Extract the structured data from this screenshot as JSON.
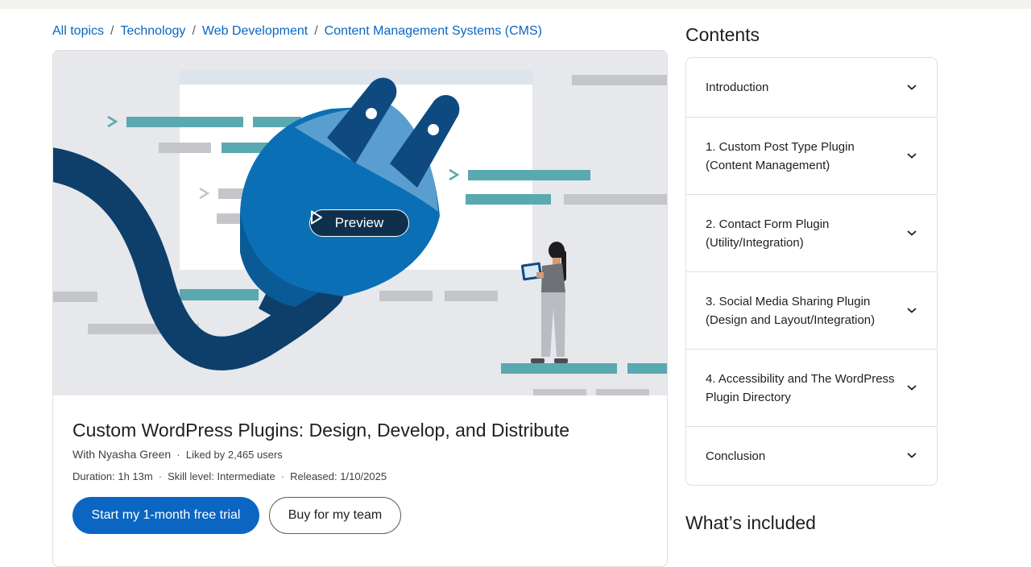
{
  "breadcrumb": {
    "items": [
      "All topics",
      "Technology",
      "Web Development",
      "Content Management Systems (CMS)"
    ],
    "separator": "/"
  },
  "hero": {
    "preview_label": "Preview"
  },
  "course": {
    "title": "Custom WordPress Plugins: Design, Develop, and Distribute",
    "instructor": "With Nyasha Green",
    "likes": "Liked by 2,465 users",
    "duration": "Duration: 1h 13m",
    "skill": "Skill level: Intermediate",
    "released": "Released: 1/10/2025",
    "primary_cta": "Start my 1-month free trial",
    "secondary_cta": "Buy for my team"
  },
  "contents": {
    "title": "Contents",
    "items": [
      "Introduction",
      "1. Custom Post Type Plugin (Content Management)",
      "2. Contact Form Plugin (Utility/Integration)",
      "3. Social Media Sharing Plugin (Design and Layout/Integration)",
      "4. Accessibility and The WordPress Plugin Directory",
      "Conclusion"
    ]
  },
  "included": {
    "title": "What’s included"
  },
  "colors": {
    "link": "#0a66c2",
    "primary_button": "#0a66c2",
    "hero_background": "#e6e8ec",
    "plug_blue": "#0b6fb5",
    "cable_navy": "#0e3f6b",
    "accent_teal": "#5aa8b0"
  }
}
